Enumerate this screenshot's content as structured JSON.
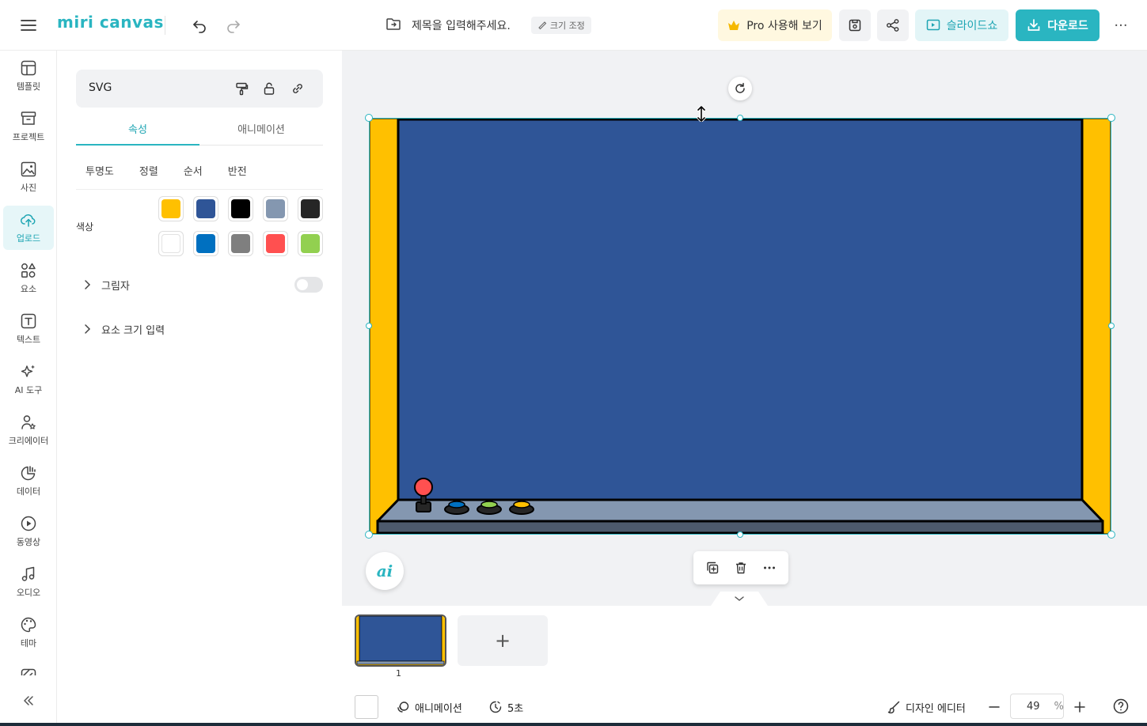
{
  "app": {
    "logo_text": "miri canvas",
    "brand_color": "#2ab5c1"
  },
  "header": {
    "document_title": "제목을 입력해주세요.",
    "resize_label": "크기 조정",
    "pro_label": "Pro 사용해 보기",
    "slideshow_label": "슬라이드쇼",
    "download_label": "다운로드",
    "more_label": "···"
  },
  "rail": {
    "items": [
      {
        "label": "템플릿",
        "icon": "template-icon"
      },
      {
        "label": "프로젝트",
        "icon": "project-icon"
      },
      {
        "label": "사진",
        "icon": "photo-icon"
      },
      {
        "label": "업로드",
        "icon": "upload-cloud-icon",
        "active": true
      },
      {
        "label": "요소",
        "icon": "elements-icon"
      },
      {
        "label": "텍스트",
        "icon": "text-icon"
      },
      {
        "label": "AI 도구",
        "icon": "ai-sparkle-icon"
      },
      {
        "label": "크리에이터",
        "icon": "creator-icon"
      },
      {
        "label": "데이터",
        "icon": "data-chart-icon"
      },
      {
        "label": "동영상",
        "icon": "video-play-icon"
      },
      {
        "label": "오디오",
        "icon": "audio-note-icon"
      },
      {
        "label": "테마",
        "icon": "palette-icon"
      }
    ]
  },
  "panel": {
    "selection_name": "SVG",
    "tabs": [
      "속성",
      "애니메이션"
    ],
    "subtabs": [
      "투명도",
      "정렬",
      "순서",
      "반전"
    ],
    "color_label": "색상",
    "colors": [
      "#ffc000",
      "#2f5597",
      "#000000",
      "#8497b0",
      "#262626",
      "#ffffff",
      "#0070c0",
      "#7f7f7f",
      "#ff5050",
      "#92d050"
    ],
    "shadow_label": "그림자",
    "size_input_label": "요소 크기 입력"
  },
  "canvas": {
    "artwork_colors": {
      "frame": "#ffc000",
      "screen": "#2f5597",
      "panel": "#8497b0",
      "panel_dark": "#4d5a6c"
    }
  },
  "pages": {
    "page_number": "1",
    "add_label": "+"
  },
  "bottombar": {
    "animation_label": "애니메이션",
    "duration_label": "5초",
    "design_editor_label": "디자인 에디터",
    "zoom_value": "49",
    "zoom_unit": "%"
  }
}
